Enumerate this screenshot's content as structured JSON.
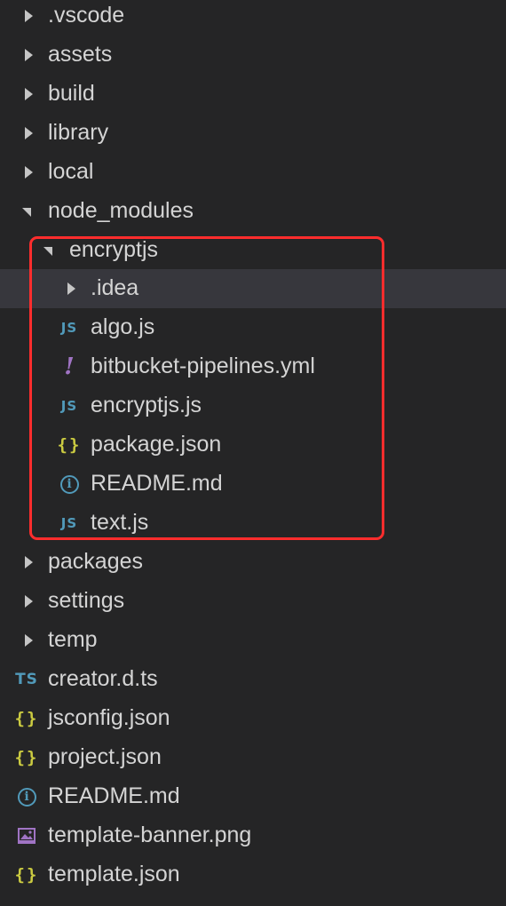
{
  "explorer": {
    "items": [
      {
        "label": ".vscode",
        "type": "folder",
        "expanded": false,
        "depth": 0
      },
      {
        "label": "assets",
        "type": "folder",
        "expanded": false,
        "depth": 0
      },
      {
        "label": "build",
        "type": "folder",
        "expanded": false,
        "depth": 0
      },
      {
        "label": "library",
        "type": "folder",
        "expanded": false,
        "depth": 0
      },
      {
        "label": "local",
        "type": "folder",
        "expanded": false,
        "depth": 0
      },
      {
        "label": "node_modules",
        "type": "folder",
        "expanded": true,
        "depth": 0
      },
      {
        "label": "encryptjs",
        "type": "folder",
        "expanded": true,
        "depth": 1
      },
      {
        "label": ".idea",
        "type": "folder",
        "expanded": false,
        "depth": 2,
        "selected": true
      },
      {
        "label": "algo.js",
        "type": "file",
        "icon": "js-icon",
        "icon_text": "JS",
        "depth": 2
      },
      {
        "label": "bitbucket-pipelines.yml",
        "type": "file",
        "icon": "yaml-icon",
        "icon_text": "!",
        "depth": 2
      },
      {
        "label": "encryptjs.js",
        "type": "file",
        "icon": "js-icon",
        "icon_text": "JS",
        "depth": 2
      },
      {
        "label": "package.json",
        "type": "file",
        "icon": "json-icon",
        "icon_text": "{}",
        "depth": 2
      },
      {
        "label": "README.md",
        "type": "file",
        "icon": "info-icon",
        "icon_text": "i",
        "depth": 2
      },
      {
        "label": "text.js",
        "type": "file",
        "icon": "js-icon",
        "icon_text": "JS",
        "depth": 2
      },
      {
        "label": "packages",
        "type": "folder",
        "expanded": false,
        "depth": 0
      },
      {
        "label": "settings",
        "type": "folder",
        "expanded": false,
        "depth": 0
      },
      {
        "label": "temp",
        "type": "folder",
        "expanded": false,
        "depth": 0
      },
      {
        "label": "creator.d.ts",
        "type": "file",
        "icon": "ts-icon",
        "icon_text": "TS",
        "depth": 0
      },
      {
        "label": "jsconfig.json",
        "type": "file",
        "icon": "json-icon",
        "icon_text": "{}",
        "depth": 0
      },
      {
        "label": "project.json",
        "type": "file",
        "icon": "json-icon",
        "icon_text": "{}",
        "depth": 0
      },
      {
        "label": "README.md",
        "type": "file",
        "icon": "info-icon",
        "icon_text": "i",
        "depth": 0
      },
      {
        "label": "template-banner.png",
        "type": "file",
        "icon": "image-icon",
        "depth": 0
      },
      {
        "label": "template.json",
        "type": "file",
        "icon": "json-icon",
        "icon_text": "{}",
        "depth": 0
      }
    ]
  },
  "colors": {
    "background": "#252526",
    "selection": "#37373d",
    "text": "#d4d4d4",
    "js": "#519aba",
    "json": "#cbcb41",
    "yaml": "#a074c4",
    "annotation_box": "#ff2d2d"
  }
}
